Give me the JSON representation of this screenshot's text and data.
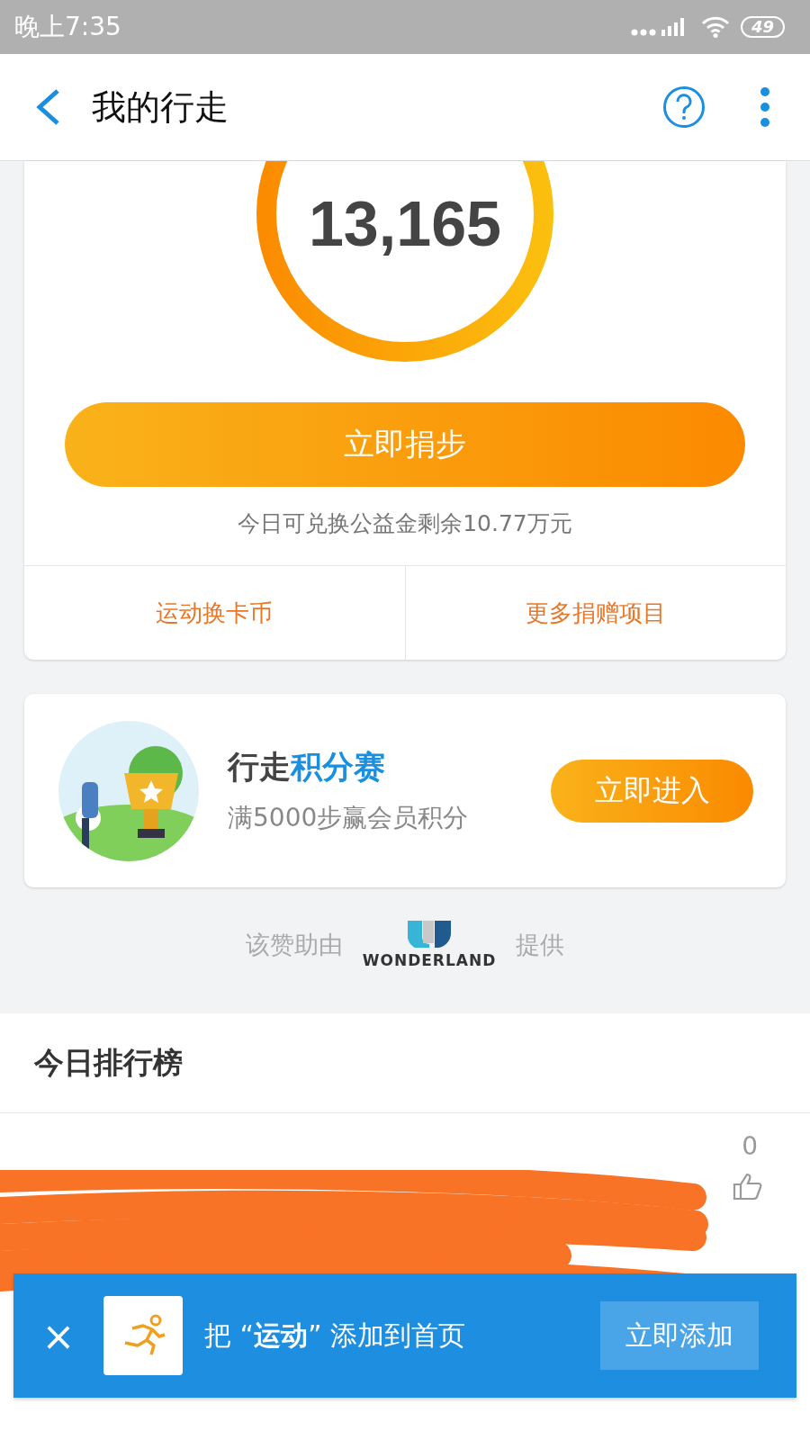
{
  "status_bar": {
    "time": "晚上7:35",
    "battery": "49"
  },
  "header": {
    "title": "我的行走"
  },
  "steps_card": {
    "count": "13,165",
    "donate_button": "立即捐步",
    "note": "今日可兑换公益金剩余10.77万元",
    "links": [
      "运动换卡币",
      "更多捐赠项目"
    ]
  },
  "promo_card": {
    "title": "行走",
    "title_highlight": "积分赛",
    "subtitle": "满5000步赢会员积分",
    "button": "立即进入"
  },
  "sponsor": {
    "prefix": "该赞助由",
    "logo_text": "WONDERLAND",
    "suffix": "提供"
  },
  "ranking": {
    "title": "今日排行榜",
    "rows": [
      {
        "likes": "0"
      }
    ]
  },
  "banner": {
    "close": "×",
    "text": "把 “**运动**” 添加到首页",
    "button": "立即添加"
  }
}
